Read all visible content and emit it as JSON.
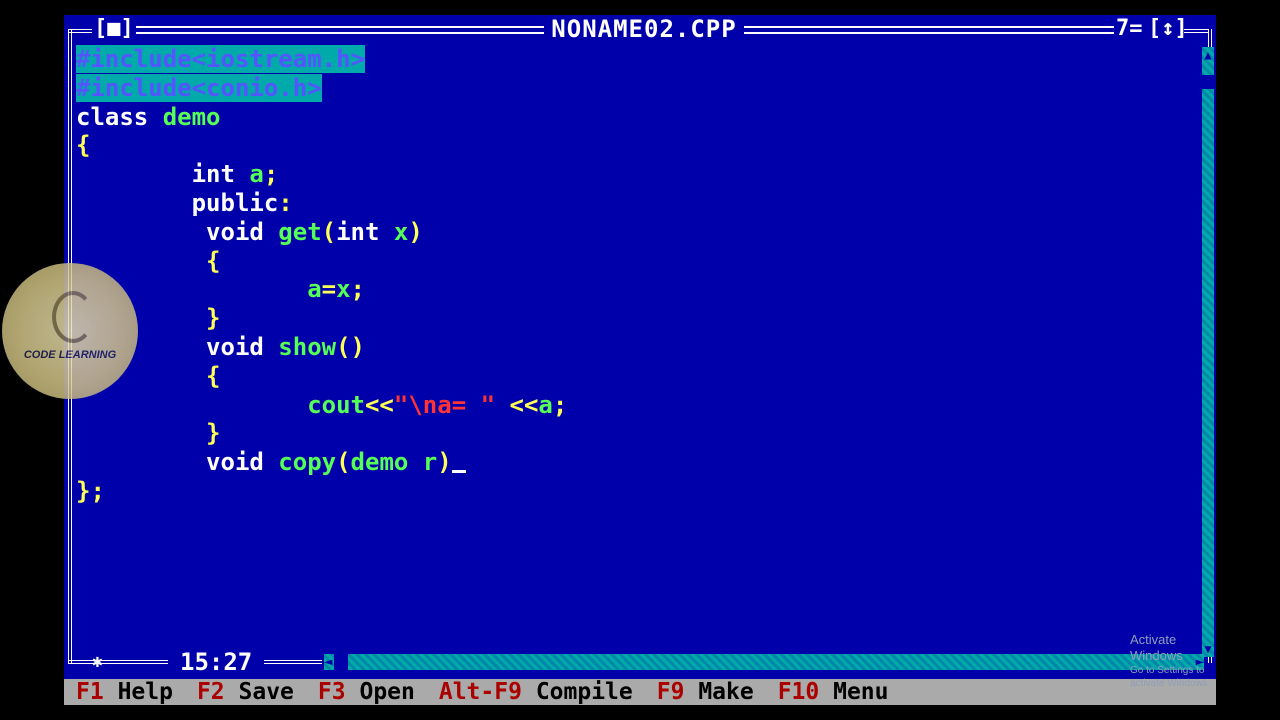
{
  "window": {
    "title": "NONAME02.CPP",
    "close_button": "[■]",
    "window_number": "7=",
    "zoom_button": "[↕]"
  },
  "editor": {
    "cursor_position": "15:27",
    "lines": [
      [
        {
          "t": "#include<iostream.h>",
          "c": "pre"
        }
      ],
      [
        {
          "t": "#include<conio.h>",
          "c": "pre"
        }
      ],
      [
        {
          "t": "class ",
          "c": "kw"
        },
        {
          "t": "demo",
          "c": "id"
        }
      ],
      [
        {
          "t": "{",
          "c": "sym"
        }
      ],
      [
        {
          "t": "        int ",
          "c": "kw"
        },
        {
          "t": "a",
          "c": "id"
        },
        {
          "t": ";",
          "c": "sym"
        }
      ],
      [
        {
          "t": "        public",
          "c": "kw"
        },
        {
          "t": ":",
          "c": "sym"
        }
      ],
      [
        {
          "t": "         void ",
          "c": "kw"
        },
        {
          "t": "get",
          "c": "id"
        },
        {
          "t": "(",
          "c": "sym"
        },
        {
          "t": "int ",
          "c": "kw"
        },
        {
          "t": "x",
          "c": "id"
        },
        {
          "t": ")",
          "c": "sym"
        }
      ],
      [
        {
          "t": "         {",
          "c": "sym"
        }
      ],
      [
        {
          "t": "                ",
          "c": "kw"
        },
        {
          "t": "a",
          "c": "id"
        },
        {
          "t": "=",
          "c": "sym"
        },
        {
          "t": "x",
          "c": "id"
        },
        {
          "t": ";",
          "c": "sym"
        }
      ],
      [
        {
          "t": "         }",
          "c": "sym"
        }
      ],
      [
        {
          "t": "         void ",
          "c": "kw"
        },
        {
          "t": "show",
          "c": "id"
        },
        {
          "t": "()",
          "c": "sym"
        }
      ],
      [
        {
          "t": "         {",
          "c": "sym"
        }
      ],
      [
        {
          "t": "                ",
          "c": "kw"
        },
        {
          "t": "cout",
          "c": "id"
        },
        {
          "t": "<<",
          "c": "sym"
        },
        {
          "t": "\"\\na= \"",
          "c": "str"
        },
        {
          "t": " <<",
          "c": "sym"
        },
        {
          "t": "a",
          "c": "id"
        },
        {
          "t": ";",
          "c": "sym"
        }
      ],
      [
        {
          "t": "         }",
          "c": "sym"
        }
      ],
      [
        {
          "t": "         void ",
          "c": "kw"
        },
        {
          "t": "copy",
          "c": "id"
        },
        {
          "t": "(",
          "c": "sym"
        },
        {
          "t": "demo ",
          "c": "id"
        },
        {
          "t": "r",
          "c": "id"
        },
        {
          "t": ")",
          "c": "sym"
        },
        {
          "t": "",
          "c": "cursor"
        }
      ],
      [
        {
          "t": "};",
          "c": "sym"
        }
      ]
    ]
  },
  "status_bar": {
    "items": [
      {
        "key": "F1",
        "label": "Help"
      },
      {
        "key": "F2",
        "label": "Save"
      },
      {
        "key": "F3",
        "label": "Open"
      },
      {
        "key": "Alt-F9",
        "label": "Compile"
      },
      {
        "key": "F9",
        "label": "Make"
      },
      {
        "key": "F10",
        "label": "Menu"
      }
    ]
  },
  "watermark_logo": {
    "text": "CODE LEARNING"
  },
  "os_notice": {
    "line1": "Activate Windows",
    "line2": "Go to Settings to activate Windows."
  },
  "colors": {
    "editor_bg": "#0000aa",
    "keyword": "#ffffff",
    "identifier": "#55ff55",
    "symbol": "#ffff55",
    "string": "#ff3333",
    "status_bg": "#aaaaaa",
    "hotkey": "#aa0000"
  }
}
